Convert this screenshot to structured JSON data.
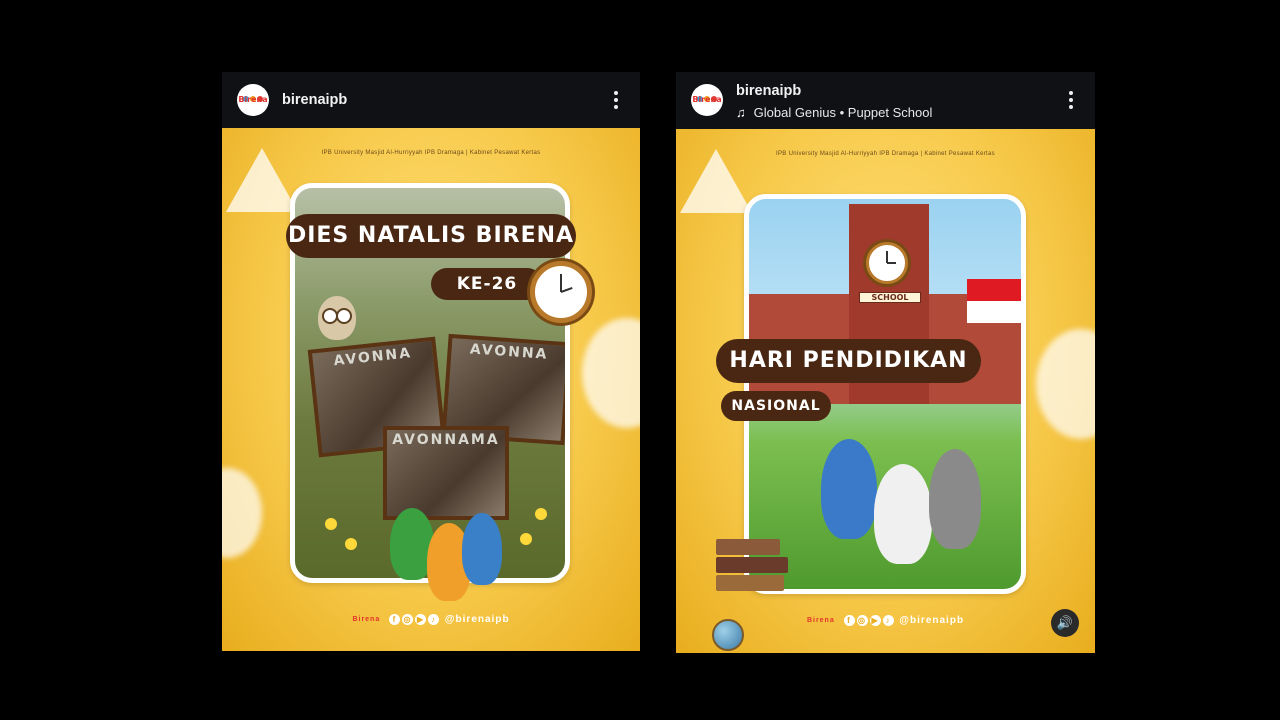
{
  "posts": [
    {
      "username": "birenaipb",
      "avatar_text": "Birena",
      "media": {
        "logos": "IPB University  Masjid Al-Hurriyyah IPB Dramaga  |  Kabinet Pesawat Kertas",
        "title": "DIES NATALIS BIRENA",
        "subtitle": "KE-26",
        "photo_texts": [
          "AVONNA",
          "AVONNA",
          "AVONNAMA"
        ],
        "footer_handle": "@birenaipb",
        "footer_brand": "Birena"
      }
    },
    {
      "username": "birenaipb",
      "avatar_text": "Birena",
      "music": "Global Genius • Puppet School",
      "media": {
        "logos": "IPB University  Masjid Al-Hurriyyah IPB Dramaga  |  Kabinet Pesawat Kertas",
        "school_sign": "SCHOOL",
        "title": "HARI PENDIDIKAN",
        "subtitle": "NASIONAL",
        "footer_handle": "@birenaipb",
        "footer_brand": "Birena"
      }
    }
  ],
  "icons": {
    "more": "more-vertical-icon",
    "music": "music-note-icon",
    "sound": "speaker-icon",
    "note_glyph": "♫",
    "sound_glyph": "🔊"
  },
  "colors": {
    "background": "#000000",
    "header": "#0f1115",
    "poster_yellow": "#f7c94a",
    "title_brown": "#4a2713"
  }
}
